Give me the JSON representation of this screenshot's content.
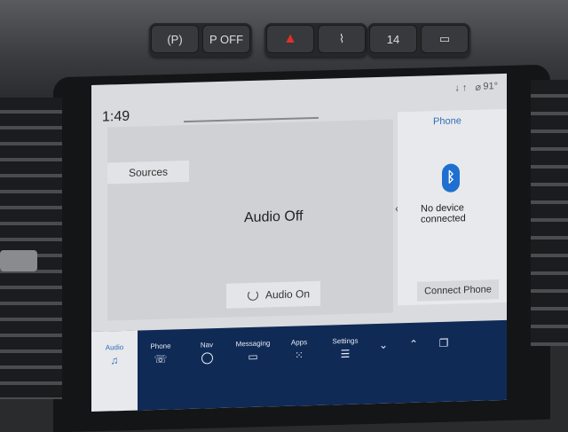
{
  "hardware_buttons": {
    "group1": [
      "(P)",
      "P OFF"
    ],
    "group2": [
      "▲",
      "⌇"
    ],
    "group3": [
      "14",
      "▭"
    ]
  },
  "screen": {
    "clock": "1:49",
    "status_icons": "↓↑ ⌀",
    "temperature": "91°",
    "audio": {
      "sources_label": "Sources",
      "state_label": "Audio Off",
      "audio_on_label": "Audio On"
    },
    "phone": {
      "title": "Phone",
      "status": "No device connected",
      "connect_label": "Connect Phone"
    },
    "nav": [
      {
        "label": "Audio",
        "icon": "music-icon"
      },
      {
        "label": "Phone",
        "icon": "phone-icon"
      },
      {
        "label": "Nav",
        "icon": "nav-icon"
      },
      {
        "label": "Messaging",
        "icon": "message-icon"
      },
      {
        "label": "Apps",
        "icon": "apps-icon"
      },
      {
        "label": "Settings",
        "icon": "settings-icon"
      }
    ]
  }
}
